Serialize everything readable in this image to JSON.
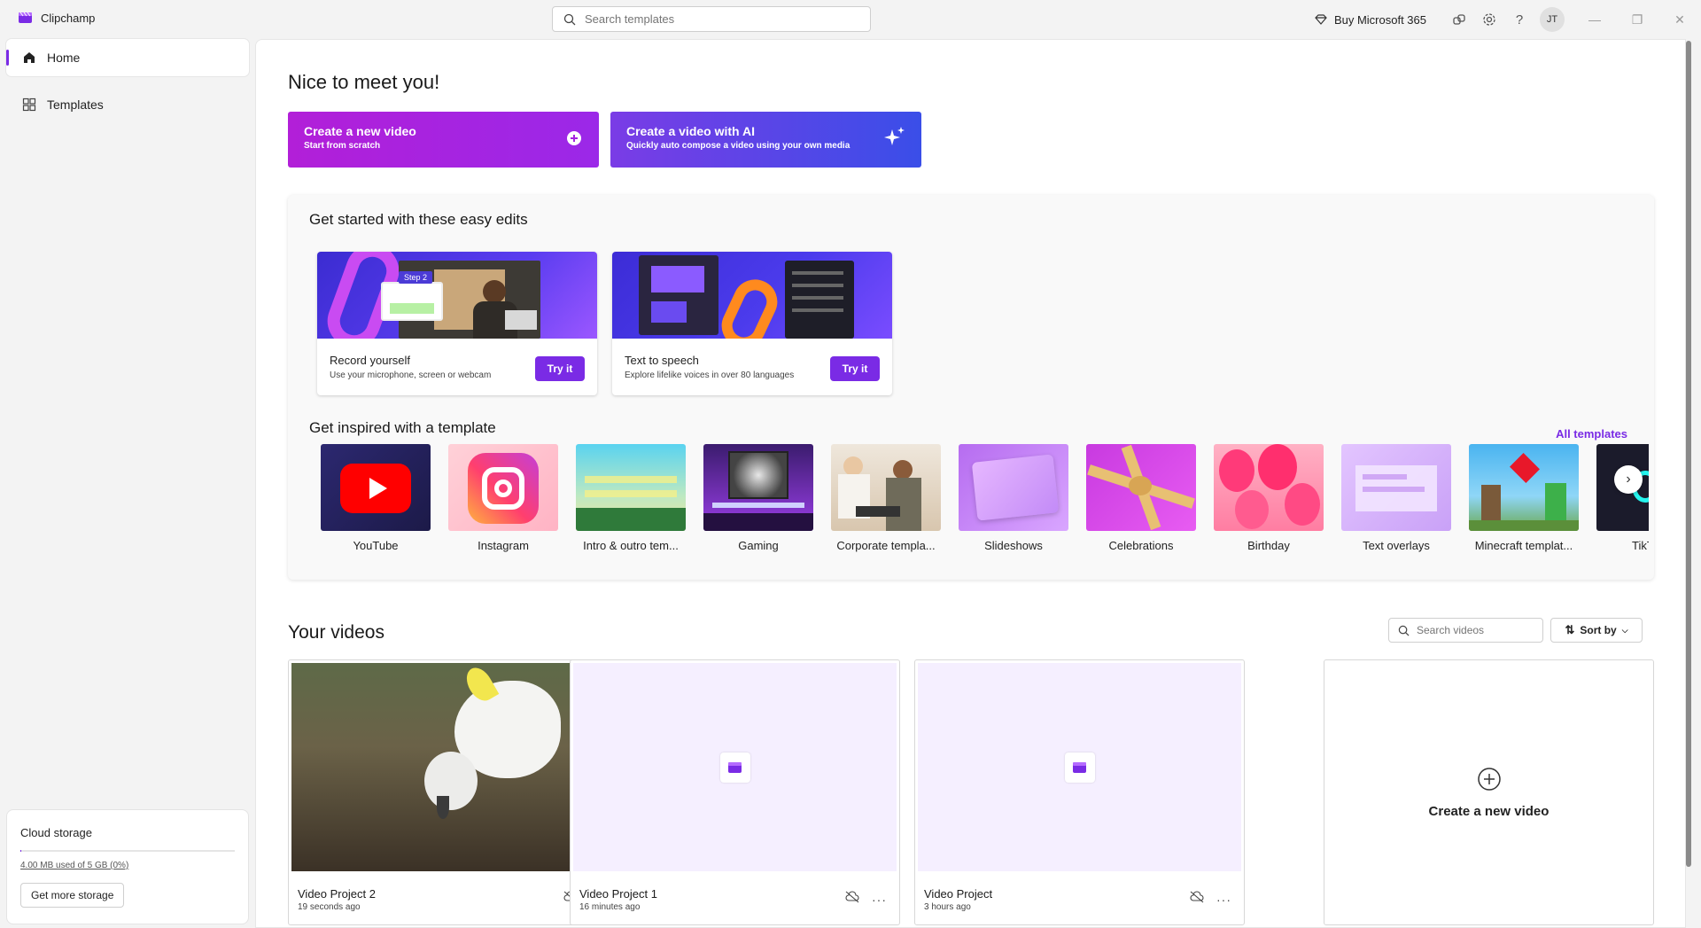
{
  "app": {
    "name": "Clipchamp"
  },
  "titlebar": {
    "search_placeholder": "Search templates",
    "buy_label": "Buy Microsoft 365",
    "avatar_initials": "JT"
  },
  "sidebar": {
    "items": [
      {
        "label": "Home",
        "icon": "home-icon"
      },
      {
        "label": "Templates",
        "icon": "templates-icon"
      }
    ],
    "storage": {
      "title": "Cloud storage",
      "used_text": "4.00 MB used of 5 GB (0%)",
      "used_fraction": 0.0008,
      "button_label": "Get more storage"
    }
  },
  "main": {
    "greeting": "Nice to meet you!",
    "cta_new": {
      "title": "Create a new video",
      "subtitle": "Start from scratch"
    },
    "cta_ai": {
      "title": "Create a video with AI",
      "subtitle": "Quickly auto compose a video using your own media"
    },
    "easy_edits": {
      "heading": "Get started with these easy edits",
      "cards": [
        {
          "title": "Record yourself",
          "subtitle": "Use your microphone, screen or webcam",
          "button": "Try it",
          "thumb_text": "Step 2"
        },
        {
          "title": "Text to speech",
          "subtitle": "Explore lifelike voices in over 80 languages",
          "button": "Try it"
        }
      ]
    },
    "templates": {
      "heading": "Get inspired with a template",
      "all_label": "All templates",
      "items": [
        {
          "label": "YouTube"
        },
        {
          "label": "Instagram"
        },
        {
          "label": "Intro & outro tem..."
        },
        {
          "label": "Gaming"
        },
        {
          "label": "Corporate templa..."
        },
        {
          "label": "Slideshows"
        },
        {
          "label": "Celebrations"
        },
        {
          "label": "Birthday"
        },
        {
          "label": "Text overlays"
        },
        {
          "label": "Minecraft templat..."
        },
        {
          "label": "TikT"
        }
      ]
    },
    "videos": {
      "heading": "Your videos",
      "search_placeholder": "Search videos",
      "sort_label": "Sort by",
      "items": [
        {
          "name": "Video Project 2",
          "time": "19 seconds ago"
        },
        {
          "name": "Video Project 1",
          "time": "16 minutes ago"
        },
        {
          "name": "Video Project",
          "time": "3 hours ago"
        }
      ],
      "new_label": "Create a new video"
    }
  },
  "colors": {
    "accent": "#7a2be5",
    "cta_new": "#b21fd8",
    "cta_ai": "#3a4ee8"
  }
}
